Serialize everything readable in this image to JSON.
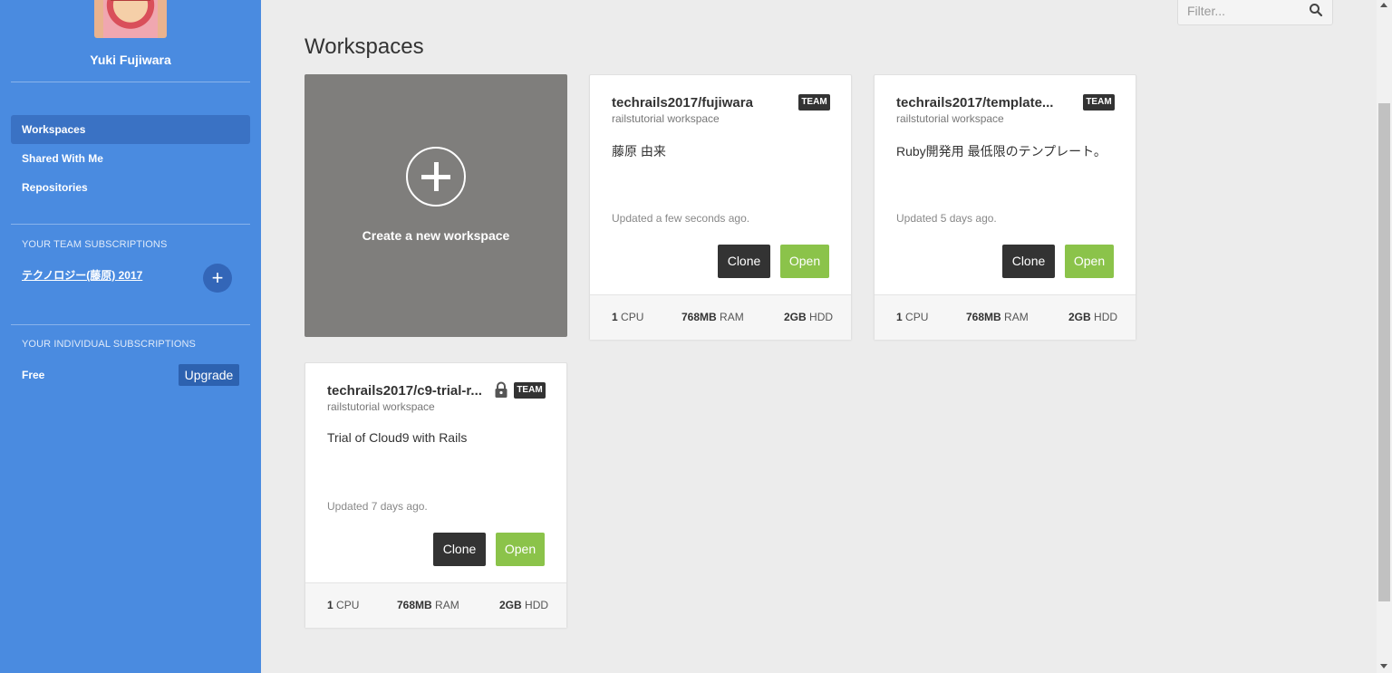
{
  "sidebar": {
    "username": "Yuki Fujiwara",
    "nav": [
      {
        "label": "Workspaces",
        "active": true
      },
      {
        "label": "Shared With Me",
        "active": false
      },
      {
        "label": "Repositories",
        "active": false
      }
    ],
    "team_section_title": "YOUR TEAM SUBSCRIPTIONS",
    "team_name": "テクノロジー(藤原) 2017",
    "add_team_icon": "plus-icon",
    "individual_section_title": "YOUR INDIVIDUAL SUBSCRIPTIONS",
    "plan": "Free",
    "upgrade_label": "Upgrade"
  },
  "main": {
    "title": "Workspaces",
    "filter_placeholder": "Filter...",
    "create_label": "Create a new workspace"
  },
  "workspaces": [
    {
      "name": "techrails2017/fujiwara",
      "type": "railstutorial workspace",
      "badge": "TEAM",
      "locked": false,
      "description": "藤原 由来",
      "updated": "Updated a few seconds ago.",
      "clone_label": "Clone",
      "open_label": "Open",
      "cpu_value": "1",
      "cpu_unit": "CPU",
      "ram_value": "768MB",
      "ram_unit": "RAM",
      "hdd_value": "2GB",
      "hdd_unit": "HDD"
    },
    {
      "name": "techrails2017/template...",
      "type": "railstutorial workspace",
      "badge": "TEAM",
      "locked": false,
      "description": "Ruby開発用 最低限のテンプレート。",
      "updated": "Updated 5 days ago.",
      "clone_label": "Clone",
      "open_label": "Open",
      "cpu_value": "1",
      "cpu_unit": "CPU",
      "ram_value": "768MB",
      "ram_unit": "RAM",
      "hdd_value": "2GB",
      "hdd_unit": "HDD"
    },
    {
      "name": "techrails2017/c9-trial-r...",
      "type": "railstutorial workspace",
      "badge": "TEAM",
      "locked": true,
      "description": "Trial of Cloud9 with Rails",
      "updated": "Updated 7 days ago.",
      "clone_label": "Clone",
      "open_label": "Open",
      "cpu_value": "1",
      "cpu_unit": "CPU",
      "ram_value": "768MB",
      "ram_unit": "RAM",
      "hdd_value": "2GB",
      "hdd_unit": "HDD"
    }
  ],
  "colors": {
    "sidebar": "#4a8be0",
    "sidebar_active": "#3a72c4",
    "open_button": "#8bc34a",
    "clone_button": "#333333",
    "create_card": "#7f7e7c"
  }
}
